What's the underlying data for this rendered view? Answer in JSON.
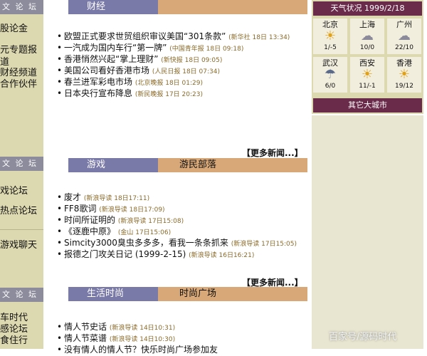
{
  "sidebar": {
    "sections": [
      {
        "header": "文 论 坛",
        "items": [
          "股论金",
          "元专题报道",
          "财经频道",
          "合作伙伴"
        ]
      },
      {
        "header": "文 论 坛",
        "items": [
          "戏论坛",
          "热点论坛",
          "游戏聊天"
        ]
      },
      {
        "header": "文 论 坛",
        "items": [
          "车时代",
          "感论坛",
          "食住行"
        ]
      }
    ]
  },
  "finance": {
    "tab_left": "财经",
    "items": [
      {
        "title": "欧盟正式要求世贸组织审议美国“301条款”",
        "source": "(新华社 18日 13:34)"
      },
      {
        "title": "一汽成为国内车行“第一牌”",
        "source": "(中国青年报 18日 09:18)"
      },
      {
        "title": "香港悄然兴起“掌上理财”",
        "source": "(新快报 18日 09:05)"
      },
      {
        "title": "美国公司看好香港市场",
        "source": "(人民日报 18日 07:34)"
      },
      {
        "title": "春兰进军彩电市场",
        "source": "(北京晚报 18日 01:29)"
      },
      {
        "title": "日本央行宣布降息",
        "source": "(新民晚报 17日 20:23)"
      }
    ],
    "more": "【更多新闻...】"
  },
  "games": {
    "tab_left": "游戏",
    "tab_right": "游民部落",
    "items": [
      {
        "title": "废才",
        "source": "(新浪导读 18日17:11)"
      },
      {
        "title": "FF8歌词",
        "source": "(新浪导读 18日17:09)"
      },
      {
        "title": "时间所证明的",
        "source": "(新浪导读 17日15:08)"
      },
      {
        "title": "《逐鹿中原》",
        "source": "(金山 17日15:06)"
      },
      {
        "title": "Simcity3000臭虫多多多，看我一条条抓来",
        "source": "(新浪导读 17日15:05)"
      },
      {
        "title": "报德之门攻关日记 (1999-2-15)",
        "source": "(新浪导读 16日16:21)"
      }
    ],
    "more": "【更多新闻...】"
  },
  "life": {
    "tab_left": "生活时尚",
    "tab_right": "时尚广场",
    "items": [
      {
        "title": "情人节史话",
        "source": "(新浪导读 14日10:31)"
      },
      {
        "title": "情人节菜谱",
        "source": "(新浪导读 14日10:30)"
      },
      {
        "title": "没有情人的情人节？快乐时尚广场参加友",
        "source": ""
      }
    ]
  },
  "weather": {
    "header": "天气状况 1999/2/18",
    "cities": [
      {
        "name": "北京",
        "temp": "1/-5",
        "icon": "sun-icon"
      },
      {
        "name": "上海",
        "temp": "10/0",
        "icon": "cloud-icon"
      },
      {
        "name": "广州",
        "temp": "22/10",
        "icon": "cloud-icon"
      },
      {
        "name": "武汉",
        "temp": "6/0",
        "icon": "rain-icon"
      },
      {
        "name": "西安",
        "temp": "11/-1",
        "icon": "sun-icon"
      },
      {
        "name": "香港",
        "temp": "19/12",
        "icon": "sun-icon"
      }
    ],
    "footer": "其它大城市"
  },
  "watermark": "百家号/源码时代"
}
